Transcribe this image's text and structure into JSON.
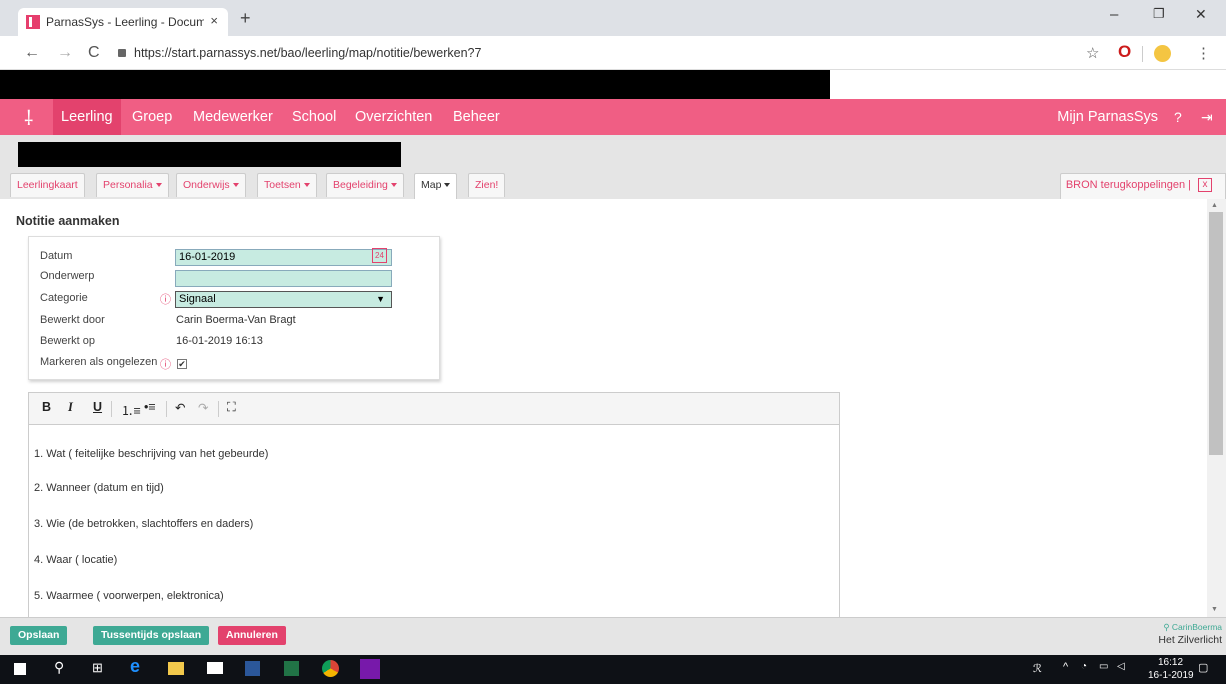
{
  "browser": {
    "tab_title": "ParnasSys - Leerling - Documenta",
    "tab_close": "×",
    "new_tab": "+",
    "url": "https://start.parnassys.net/bao/leerling/map/notitie/bewerken?7",
    "win_min": "–",
    "win_restore": "❐",
    "win_close": "✕"
  },
  "nav": {
    "items": [
      "Leerling",
      "Groep",
      "Medewerker",
      "School",
      "Overzichten",
      "Beheer"
    ],
    "active": "Leerling",
    "right_label": "Mijn ParnasSys",
    "brand_color": "#f05e84"
  },
  "subtabs": [
    "Leerlingkaart",
    "Personalia",
    "Onderwijs",
    "Toetsen",
    "Begeleiding",
    "Map",
    "Zien!"
  ],
  "bron_label": "BRON terugkoppelingen |",
  "bron_close": "x",
  "page_title": "Notitie aanmaken",
  "form": {
    "datum_label": "Datum",
    "datum_value": "16-01-2019",
    "calendar_text": "24",
    "onderwerp_label": "Onderwerp",
    "onderwerp_value": "",
    "categorie_label": "Categorie",
    "categorie_value": "Signaal",
    "bewerkt_door_label": "Bewerkt door",
    "bewerkt_door_value": "Carin Boerma-Van Bragt",
    "bewerkt_op_label": "Bewerkt op",
    "bewerkt_op_value": "16-01-2019 16:13",
    "markeren_label": "Markeren als ongelezen",
    "markeren_checked": true
  },
  "editor": {
    "toolbar": [
      "B",
      "I",
      "U"
    ],
    "lines": [
      "1. Wat ( feitelijke beschrijving van het gebeurde)",
      "2. Wanneer (datum en tijd)",
      "3. Wie (de betrokken, slachtoffers en daders)",
      "4. Waar ( locatie)",
      "5. Waarmee ( voorwerpen, elektronica)"
    ]
  },
  "buttons": {
    "opslaan": "Opslaan",
    "tussentijds": "Tussentijds opslaan",
    "annuleren": "Annuleren"
  },
  "user": {
    "name": "CarinBoerma",
    "school": "Het Zilverlicht"
  },
  "taskbar": {
    "time": "16:12",
    "date": "16-1-2019"
  }
}
